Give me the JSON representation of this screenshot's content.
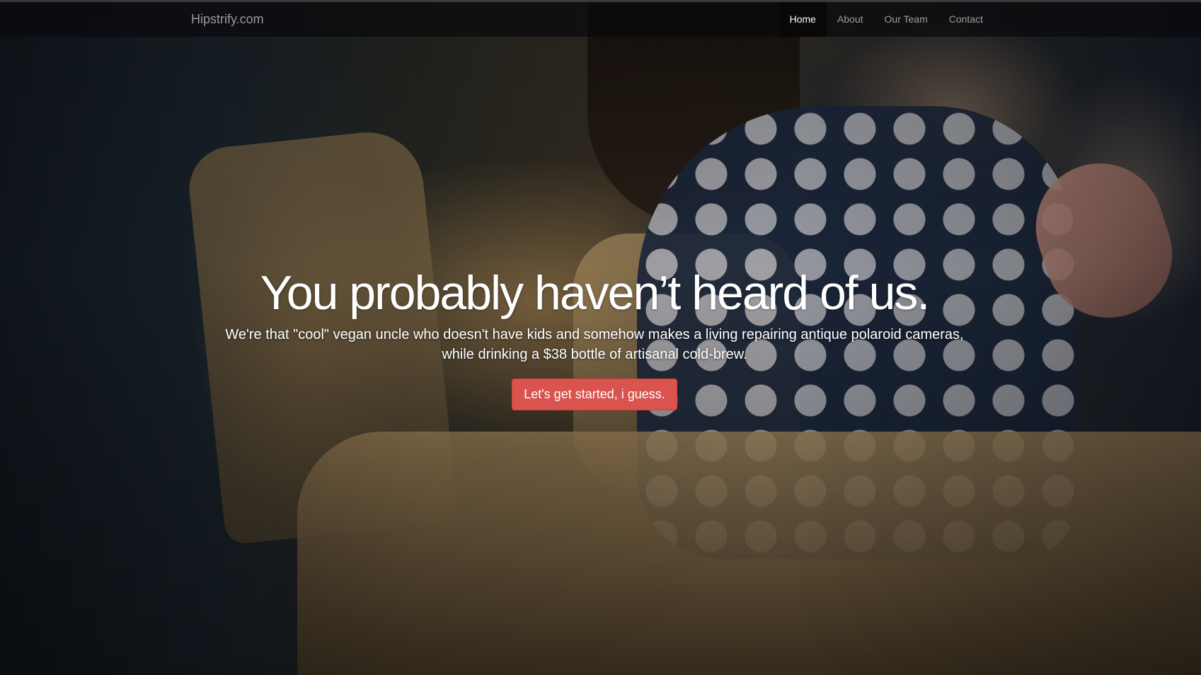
{
  "navbar": {
    "brand": "Hipstrify.com",
    "items": [
      {
        "label": "Home",
        "active": true
      },
      {
        "label": "About",
        "active": false
      },
      {
        "label": "Our Team",
        "active": false
      },
      {
        "label": "Contact",
        "active": false
      }
    ]
  },
  "hero": {
    "title": "You probably haven’t heard of us.",
    "subtitle_line1": "We're that \"cool\" vegan uncle who doesn't have kids and somehow makes a living repairing antique polaroid cameras,",
    "subtitle_line2": "while drinking a $38 bottle of artisanal cold-brew.",
    "cta_label": "Let's get started, i guess."
  },
  "colors": {
    "cta": "#d9534f",
    "navbar_bg": "#0a0a0c",
    "nav_active_bg": "#080808"
  }
}
